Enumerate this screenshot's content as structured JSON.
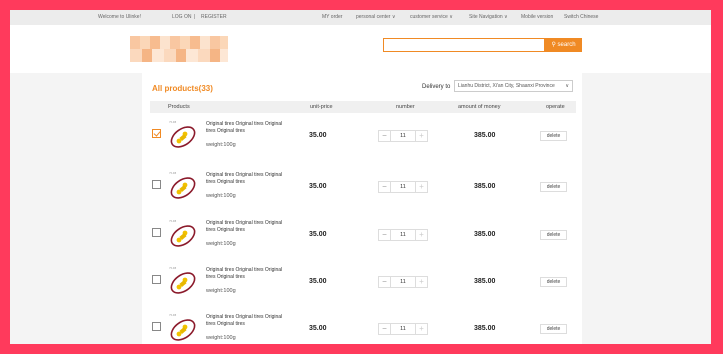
{
  "topbar": {
    "welcome": "Welcome to Ulinke!",
    "login": "LOG ON",
    "sep": "|",
    "register": "REGISTER",
    "my_order": "MY order",
    "personal_center": "personal center",
    "customer_service": "customer service",
    "site_navigation": "Site Navigation",
    "mobile_version": "Mobile version",
    "switch_chinese": "Switch Chinese"
  },
  "search": {
    "placeholder": "",
    "button_label": "search"
  },
  "cart": {
    "title": "All products(33)",
    "delivery_label": "Delivery to",
    "delivery_value": "Lianhu District, Xi'an City, Shaanxi Province",
    "columns": [
      "Products",
      "unit-price",
      "number",
      "amount of money",
      "operate"
    ],
    "items": [
      {
        "checked": true,
        "name": "Original tires Original tires Original tires Original tires",
        "weight": "weight:100g",
        "price": "35.00",
        "qty": "11",
        "amount": "385.00",
        "delete": "delete"
      },
      {
        "checked": false,
        "name": "Original tires Original tires Original tires Original tires",
        "weight": "weight:100g",
        "price": "35.00",
        "qty": "11",
        "amount": "385.00",
        "delete": "delete"
      },
      {
        "checked": false,
        "name": "Original tires Original tires Original tires Original tires",
        "weight": "weight:100g",
        "price": "35.00",
        "qty": "11",
        "amount": "385.00",
        "delete": "delete"
      },
      {
        "checked": false,
        "name": "Original tires Original tires Original tires Original tires",
        "weight": "weight:100g",
        "price": "35.00",
        "qty": "11",
        "amount": "385.00",
        "delete": "delete"
      },
      {
        "checked": false,
        "name": "Original tires Original tires Original tires Original tires",
        "weight": "weight:100g",
        "price": "35.00",
        "qty": "11",
        "amount": "385.00",
        "delete": "delete"
      }
    ]
  },
  "colors": {
    "accent": "#f08a24",
    "background": "#ff3a5c",
    "topbar": "#ececec"
  },
  "icons": {
    "chevron": "chevron-down-icon",
    "minus": "minus-icon",
    "plus": "plus-icon"
  }
}
